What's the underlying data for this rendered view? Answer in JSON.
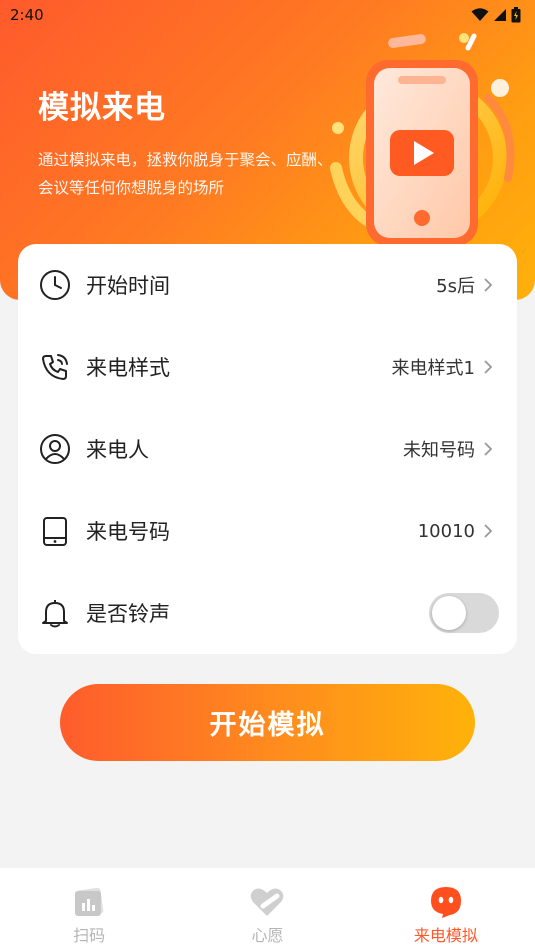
{
  "status_bar": {
    "time": "2:40"
  },
  "hero": {
    "title": "模拟来电",
    "subtitle": "通过模拟来电，拯救你脱身于聚会、应酬、会议等任何你想脱身的场所"
  },
  "settings": {
    "rows": [
      {
        "label": "开始时间",
        "value": "5s后",
        "icon": "clock-icon"
      },
      {
        "label": "来电样式",
        "value": "来电样式1",
        "icon": "phone-call-icon"
      },
      {
        "label": "来电人",
        "value": "未知号码",
        "icon": "person-icon"
      },
      {
        "label": "来电号码",
        "value": "10010",
        "icon": "mobile-device-icon"
      }
    ],
    "ringtone": {
      "label": "是否铃声",
      "icon": "bell-icon",
      "enabled": false
    }
  },
  "start_button": {
    "label": "开始模拟"
  },
  "tabbar": {
    "tabs": [
      {
        "label": "扫码",
        "icon": "scan-chart-icon",
        "active": false
      },
      {
        "label": "心愿",
        "icon": "heart-icon",
        "active": false
      },
      {
        "label": "来电模拟",
        "icon": "mascot-icon",
        "active": true
      }
    ]
  },
  "colors": {
    "accent_start": "#ff5a2c",
    "accent_end": "#ffb10a",
    "active_tab": "#ff5a2c",
    "inactive_tab": "#b5b5b5"
  }
}
